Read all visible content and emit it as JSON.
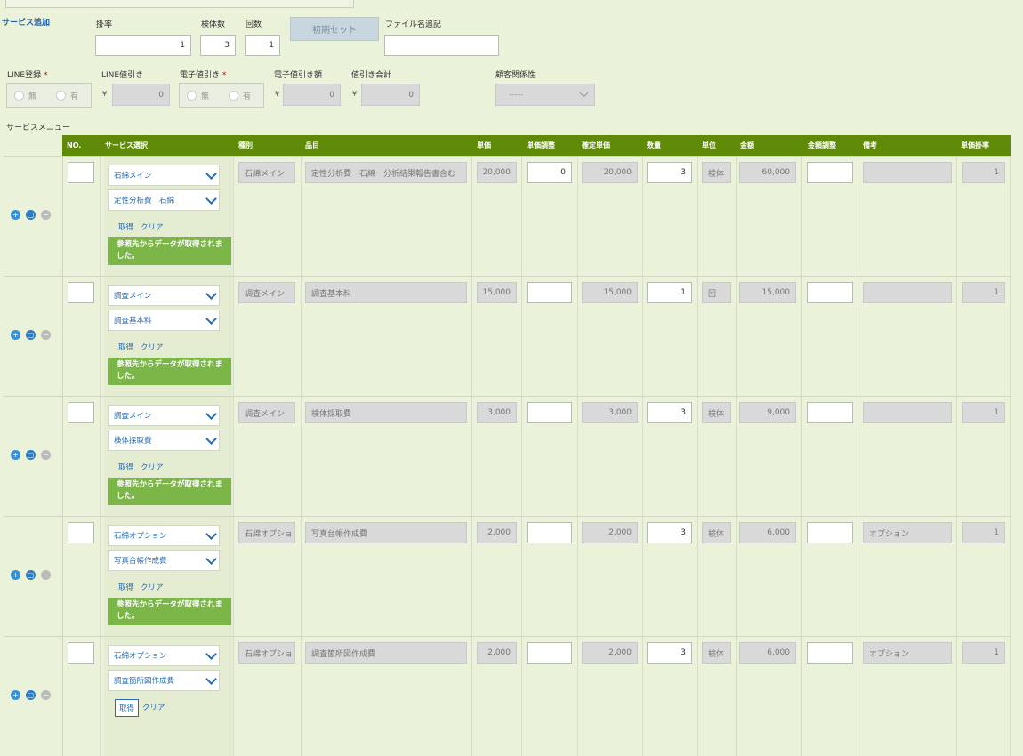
{
  "header": {
    "service_add": "サービス追加",
    "rate_label": "掛率",
    "rate_value": "1",
    "samples_label": "検体数",
    "samples_value": "3",
    "times_label": "回数",
    "times_value": "1",
    "init_button": "初期セット",
    "filename_label": "ファイル名追記",
    "filename_value": ""
  },
  "discounts": {
    "line_label": "LINE登録",
    "req_mark": "*",
    "line_none": "無",
    "line_yes": "有",
    "line_discount_label": "LINE値引き",
    "line_discount_value": "0",
    "e_label": "電子値引き",
    "e_none": "無",
    "e_yes": "有",
    "e_amount_label": "電子値引き額",
    "e_amount_value": "0",
    "total_label": "値引き合計",
    "total_value": "0",
    "customer_label": "顧客関係性",
    "customer_value": "-----",
    "yen": "¥"
  },
  "menu": {
    "title": "サービスメニュー",
    "columns": [
      "NO.",
      "サービス選択",
      "種別",
      "品目",
      "単価",
      "単価調整",
      "確定単価",
      "数量",
      "単位",
      "金額",
      "金額調整",
      "備考",
      "単価掛率"
    ],
    "get_label": "取得",
    "clear_label": "クリア",
    "message": "参照先からデータが取得されました。",
    "rows": [
      {
        "no": "",
        "service1": "石綿メイン",
        "service2": "定性分析費　石綿",
        "kind": "石綿メイン",
        "item": "定性分析費　石綿　分析結果報告書含む",
        "unit_price": "20,000",
        "price_adj": "0",
        "final_price": "20,000",
        "qty": "3",
        "unit": "検体",
        "amount": "60,000",
        "amount_adj": "",
        "note": "",
        "rate": "1",
        "show_msg": true
      },
      {
        "no": "",
        "service1": "調査メイン",
        "service2": "調査基本料",
        "kind": "調査メイン",
        "item": "調査基本料",
        "unit_price": "15,000",
        "price_adj": "",
        "final_price": "15,000",
        "qty": "1",
        "unit": "回",
        "amount": "15,000",
        "amount_adj": "",
        "note": "",
        "rate": "1",
        "show_msg": true
      },
      {
        "no": "",
        "service1": "調査メイン",
        "service2": "検体採取費",
        "kind": "調査メイン",
        "item": "検体採取費",
        "unit_price": "3,000",
        "price_adj": "",
        "final_price": "3,000",
        "qty": "3",
        "unit": "検体",
        "amount": "9,000",
        "amount_adj": "",
        "note": "",
        "rate": "1",
        "show_msg": true
      },
      {
        "no": "",
        "service1": "石綿オプション",
        "service2": "写真台帳作成費",
        "kind": "石綿オプショ",
        "item": "写真台帳作成費",
        "unit_price": "2,000",
        "price_adj": "",
        "final_price": "2,000",
        "qty": "3",
        "unit": "検体",
        "amount": "6,000",
        "amount_adj": "",
        "note": "オプション",
        "rate": "1",
        "show_msg": true
      },
      {
        "no": "",
        "service1": "石綿オプション",
        "service2": "調査箇所図作成費",
        "kind": "石綿オプショ",
        "item": "調査箇所図作成費",
        "unit_price": "2,000",
        "price_adj": "",
        "final_price": "2,000",
        "qty": "3",
        "unit": "検体",
        "amount": "6,000",
        "amount_adj": "",
        "note": "オプション",
        "rate": "1",
        "show_msg": false
      }
    ]
  },
  "colors": {
    "header_bg": "#5f8a08",
    "message_bg": "#7cb548",
    "page_bg": "#ebf2da",
    "link": "#2a6bb0"
  }
}
